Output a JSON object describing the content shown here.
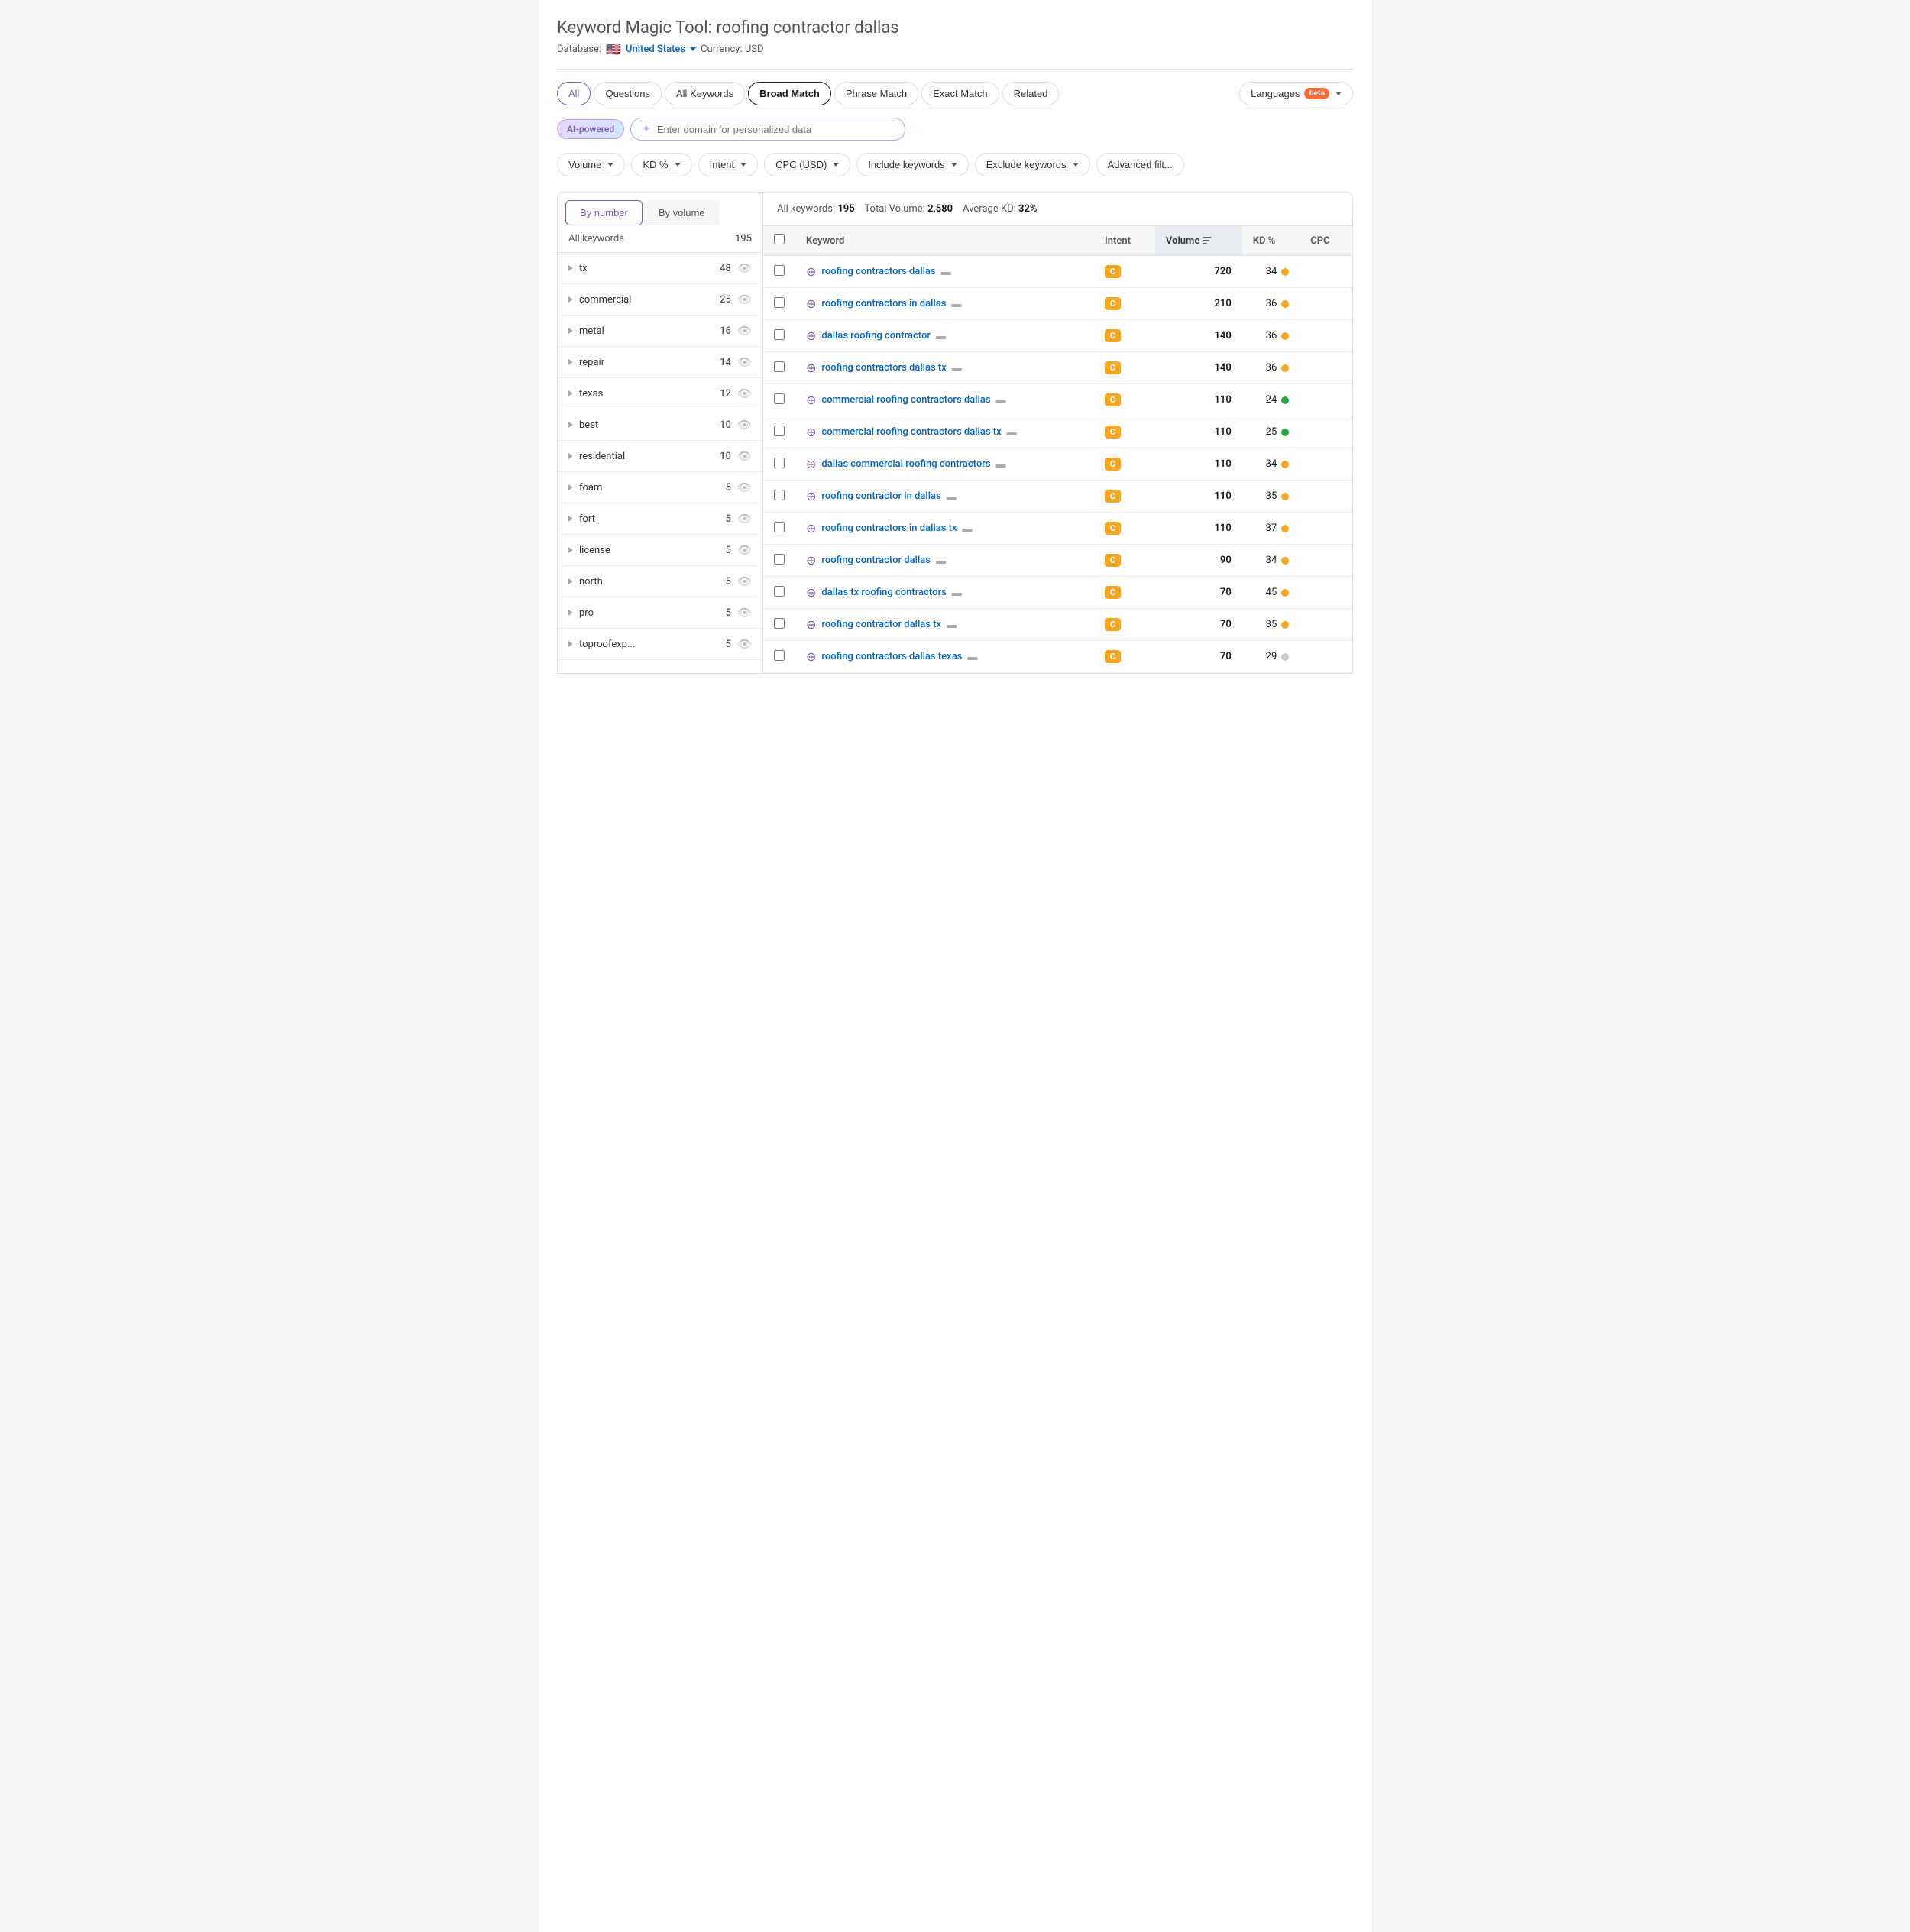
{
  "header": {
    "tool_name": "Keyword Magic Tool:",
    "search_query": "roofing contractor dallas",
    "database_label": "Database:",
    "database_value": "United States",
    "currency_label": "Currency: USD"
  },
  "tabs": [
    {
      "id": "all",
      "label": "All",
      "active": true
    },
    {
      "id": "questions",
      "label": "Questions",
      "active": false
    },
    {
      "id": "all-keywords",
      "label": "All Keywords",
      "active": false
    },
    {
      "id": "broad-match",
      "label": "Broad Match",
      "active": false
    },
    {
      "id": "phrase-match",
      "label": "Phrase Match",
      "active": false
    },
    {
      "id": "exact-match",
      "label": "Exact Match",
      "active": false
    },
    {
      "id": "related",
      "label": "Related",
      "active": false
    },
    {
      "id": "languages",
      "label": "Languages",
      "active": false,
      "badge": "beta"
    }
  ],
  "ai_section": {
    "ai_powered_label": "AI-powered",
    "input_placeholder": "Enter domain for personalized data"
  },
  "filters": [
    {
      "id": "volume",
      "label": "Volume"
    },
    {
      "id": "kd",
      "label": "KD %"
    },
    {
      "id": "intent",
      "label": "Intent"
    },
    {
      "id": "cpc",
      "label": "CPC (USD)"
    },
    {
      "id": "include",
      "label": "Include keywords"
    },
    {
      "id": "exclude",
      "label": "Exclude keywords"
    },
    {
      "id": "advanced",
      "label": "Advanced filt..."
    }
  ],
  "sidebar": {
    "tab_by_number": "By number",
    "tab_by_volume": "By volume",
    "all_keywords_label": "All keywords",
    "all_keywords_count": "195",
    "items": [
      {
        "label": "tx",
        "count": "48"
      },
      {
        "label": "commercial",
        "count": "25"
      },
      {
        "label": "metal",
        "count": "16"
      },
      {
        "label": "repair",
        "count": "14"
      },
      {
        "label": "texas",
        "count": "12"
      },
      {
        "label": "best",
        "count": "10"
      },
      {
        "label": "residential",
        "count": "10"
      },
      {
        "label": "foam",
        "count": "5"
      },
      {
        "label": "fort",
        "count": "5"
      },
      {
        "label": "license",
        "count": "5"
      },
      {
        "label": "north",
        "count": "5"
      },
      {
        "label": "pro",
        "count": "5"
      },
      {
        "label": "toproofexp...",
        "count": "5"
      }
    ]
  },
  "table": {
    "stats": {
      "all_keywords_label": "All keywords:",
      "all_keywords_count": "195",
      "total_volume_label": "Total Volume:",
      "total_volume_value": "2,580",
      "avg_kd_label": "Average KD:",
      "avg_kd_value": "32%"
    },
    "columns": [
      {
        "id": "keyword",
        "label": "Keyword"
      },
      {
        "id": "intent",
        "label": "Intent"
      },
      {
        "id": "volume",
        "label": "Volume"
      },
      {
        "id": "kd",
        "label": "KD %"
      },
      {
        "id": "cpc",
        "label": "CPC"
      }
    ],
    "rows": [
      {
        "keyword": "roofing contractors dallas",
        "intent": "C",
        "volume": "720",
        "kd": "34",
        "kd_dot": "yellow"
      },
      {
        "keyword": "roofing contractors in dallas",
        "intent": "C",
        "volume": "210",
        "kd": "36",
        "kd_dot": "yellow"
      },
      {
        "keyword": "dallas roofing contractor",
        "intent": "C",
        "volume": "140",
        "kd": "36",
        "kd_dot": "yellow"
      },
      {
        "keyword": "roofing contractors dallas tx",
        "intent": "C",
        "volume": "140",
        "kd": "36",
        "kd_dot": "yellow"
      },
      {
        "keyword": "commercial roofing contractors dallas",
        "intent": "C",
        "volume": "110",
        "kd": "24",
        "kd_dot": "green"
      },
      {
        "keyword": "commercial roofing contractors dallas tx",
        "intent": "C",
        "volume": "110",
        "kd": "25",
        "kd_dot": "green"
      },
      {
        "keyword": "dallas commercial roofing contractors",
        "intent": "C",
        "volume": "110",
        "kd": "34",
        "kd_dot": "yellow"
      },
      {
        "keyword": "roofing contractor in dallas",
        "intent": "C",
        "volume": "110",
        "kd": "35",
        "kd_dot": "yellow"
      },
      {
        "keyword": "roofing contractors in dallas tx",
        "intent": "C",
        "volume": "110",
        "kd": "37",
        "kd_dot": "yellow"
      },
      {
        "keyword": "roofing contractor dallas",
        "intent": "C",
        "volume": "90",
        "kd": "34",
        "kd_dot": "yellow"
      },
      {
        "keyword": "dallas tx roofing contractors",
        "intent": "C",
        "volume": "70",
        "kd": "45",
        "kd_dot": "yellow"
      },
      {
        "keyword": "roofing contractor dallas tx",
        "intent": "C",
        "volume": "70",
        "kd": "35",
        "kd_dot": "yellow"
      },
      {
        "keyword": "roofing contractors dallas texas",
        "intent": "C",
        "volume": "70",
        "kd": "29",
        "kd_dot": "gray"
      }
    ]
  }
}
